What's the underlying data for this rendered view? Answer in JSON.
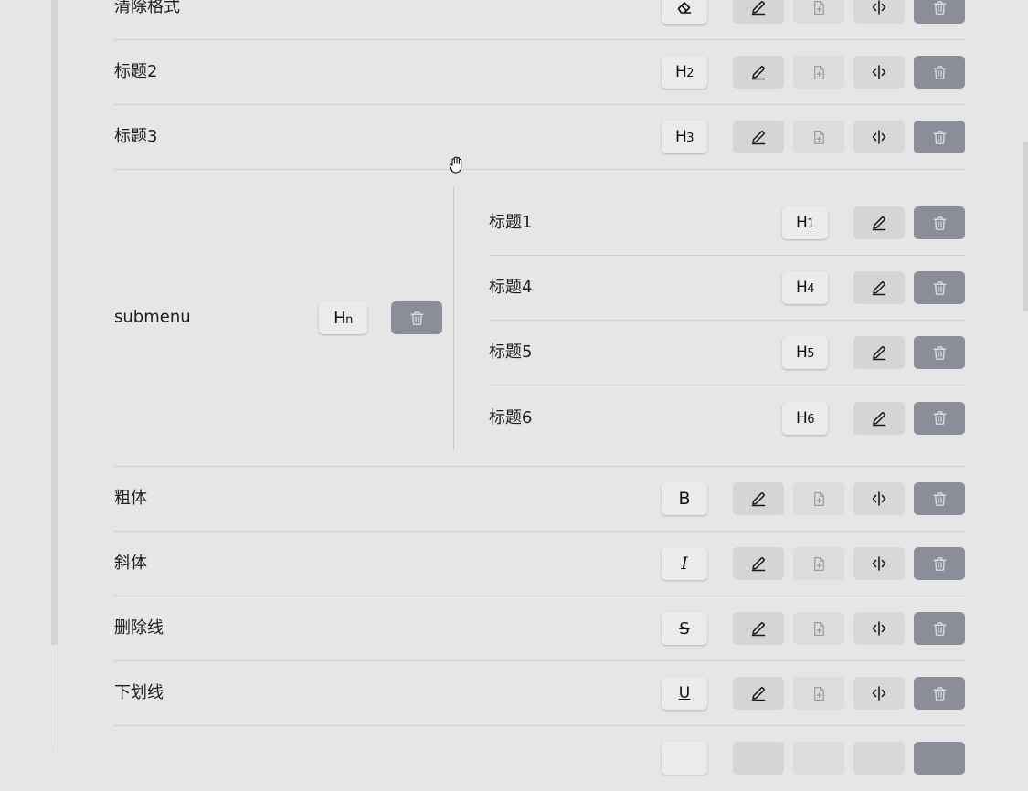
{
  "rows_top": [
    {
      "label": "清除格式",
      "glyph": "eraser"
    },
    {
      "label": "标题2",
      "glyph_text": "H",
      "glyph_sub": "2"
    },
    {
      "label": "标题3",
      "glyph_text": "H",
      "glyph_sub": "3"
    }
  ],
  "submenu": {
    "label": "submenu",
    "glyph_text": "H",
    "glyph_sub": "n",
    "items": [
      {
        "label": "标题1",
        "glyph_text": "H",
        "glyph_sub": "1"
      },
      {
        "label": "标题4",
        "glyph_text": "H",
        "glyph_sub": "4"
      },
      {
        "label": "标题5",
        "glyph_text": "H",
        "glyph_sub": "5"
      },
      {
        "label": "标题6",
        "glyph_text": "H",
        "glyph_sub": "6"
      }
    ]
  },
  "rows_bottom": [
    {
      "label": "粗体",
      "glyph_text": "B"
    },
    {
      "label": "斜体",
      "glyph_text": "I"
    },
    {
      "label": "删除线",
      "glyph_text": "S"
    },
    {
      "label": "下划线",
      "glyph_text": "U"
    }
  ],
  "icons": {
    "edit": "pencil-icon",
    "add": "file-plus-icon",
    "move": "split-icon",
    "delete": "trash-icon",
    "cursor": "grab-hand-icon"
  },
  "colors": {
    "background": "#e6e6e6",
    "delete_button": "#8b8d98",
    "edit_button": "#d5d5d5",
    "divider": "#cfcfcf"
  }
}
